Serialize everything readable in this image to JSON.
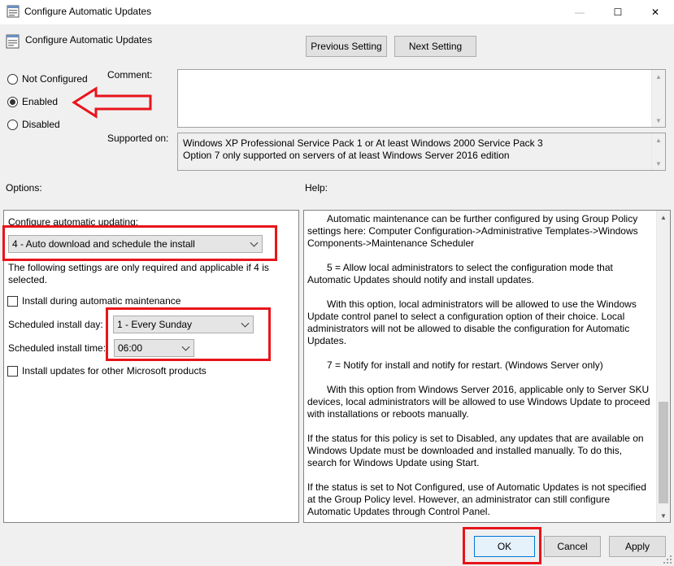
{
  "window": {
    "title": "Configure Automatic Updates",
    "icon": "policy-icon",
    "controls": {
      "minimize": "—",
      "maximize": "☐",
      "close": "✕"
    }
  },
  "header": {
    "title": "Configure Automatic Updates",
    "prev_label": "Previous Setting",
    "next_label": "Next Setting"
  },
  "state": {
    "options": [
      {
        "label": "Not Configured",
        "checked": false
      },
      {
        "label": "Enabled",
        "checked": true
      },
      {
        "label": "Disabled",
        "checked": false
      }
    ]
  },
  "comment": {
    "label": "Comment:",
    "value": ""
  },
  "supported": {
    "label": "Supported on:",
    "lines": [
      "Windows XP Professional Service Pack 1 or At least Windows 2000 Service Pack 3",
      "Option 7 only supported on servers of at least Windows Server 2016 edition"
    ]
  },
  "options_section": {
    "title": "Options:",
    "configure_label": "Configure automatic updating:",
    "configure_value": "4 - Auto download and schedule the install",
    "note": "The following settings are only required and applicable if 4 is selected.",
    "maintenance_label": "Install during automatic maintenance",
    "maintenance_checked": false,
    "day_label": "Scheduled install day:",
    "day_value": "1 - Every Sunday",
    "time_label": "Scheduled install time:",
    "time_value": "06:00",
    "other_products_label": "Install updates for other Microsoft products",
    "other_products_checked": false
  },
  "help_section": {
    "title": "Help:",
    "paragraphs": [
      {
        "text": "Automatic maintenance can be further configured by using Group Policy settings here: Computer Configuration->Administrative Templates->Windows Components->Maintenance Scheduler",
        "indent": true
      },
      {
        "text": "5 = Allow local administrators to select the configuration mode that Automatic Updates should notify and install updates.",
        "indent": true
      },
      {
        "text": "With this option, local administrators will be allowed to use the Windows Update control panel to select a configuration option of their choice. Local administrators will not be allowed to disable the configuration for Automatic Updates.",
        "indent": true
      },
      {
        "text": "7 = Notify for install and notify for restart. (Windows Server only)",
        "indent": true
      },
      {
        "text": "With this option from Windows Server 2016, applicable only to Server SKU devices, local administrators will be allowed to use Windows Update to proceed with installations or reboots manually.",
        "indent": true
      },
      {
        "text": "If the status for this policy is set to Disabled, any updates that are available on Windows Update must be downloaded and installed manually. To do this, search for Windows Update using Start.",
        "indent": false
      },
      {
        "text": "If the status is set to Not Configured, use of Automatic Updates is not specified at the Group Policy level. However, an administrator can still configure Automatic Updates through Control Panel.",
        "indent": false
      }
    ]
  },
  "footer": {
    "ok_label": "OK",
    "cancel_label": "Cancel",
    "apply_label": "Apply"
  },
  "annotation_color": "#e8141b"
}
